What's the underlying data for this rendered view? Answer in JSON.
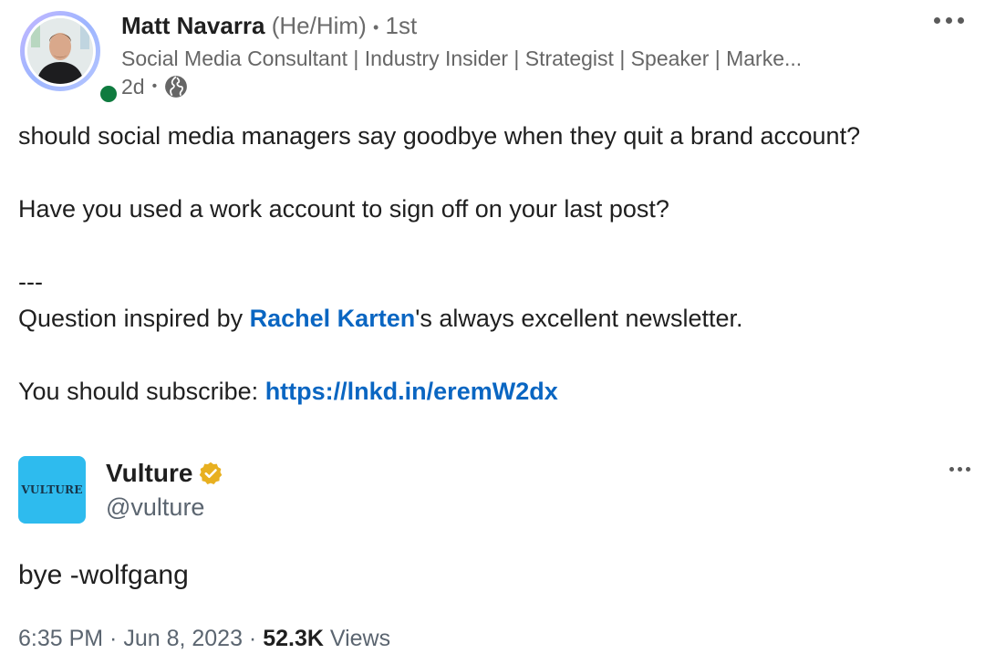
{
  "author": {
    "name": "Matt Navarra",
    "pronouns": "(He/Him)",
    "separator": "•",
    "degree": "1st",
    "headline": "Social Media Consultant | Industry Insider | Strategist | Speaker | Marke...",
    "time": "2d",
    "time_separator": "•",
    "visibility_icon": "globe-icon"
  },
  "post": {
    "line1": "should social media managers say goodbye when they quit a brand account?",
    "line2": "Have you used a work account to sign off on your last post?",
    "divider": "---",
    "line3_prefix": "Question inspired by ",
    "mention": "Rachel Karten",
    "line3_suffix": "'s always excellent newsletter.",
    "line4_prefix": "You should subscribe: ",
    "link": "https://lnkd.in/eremW2dx"
  },
  "tweet": {
    "logo_text": "VULTURE",
    "name": "Vulture",
    "handle": "@vulture",
    "text": "bye -wolfgang",
    "time": "6:35 PM · Jun 8, 2023 · ",
    "views_count": "52.3K",
    "views_label": " Views"
  },
  "colors": {
    "link": "#0a66c2",
    "presence": "#0f7b3f",
    "vulture_logo_bg": "#2ebbee",
    "verified_badge": "#e8b020"
  }
}
